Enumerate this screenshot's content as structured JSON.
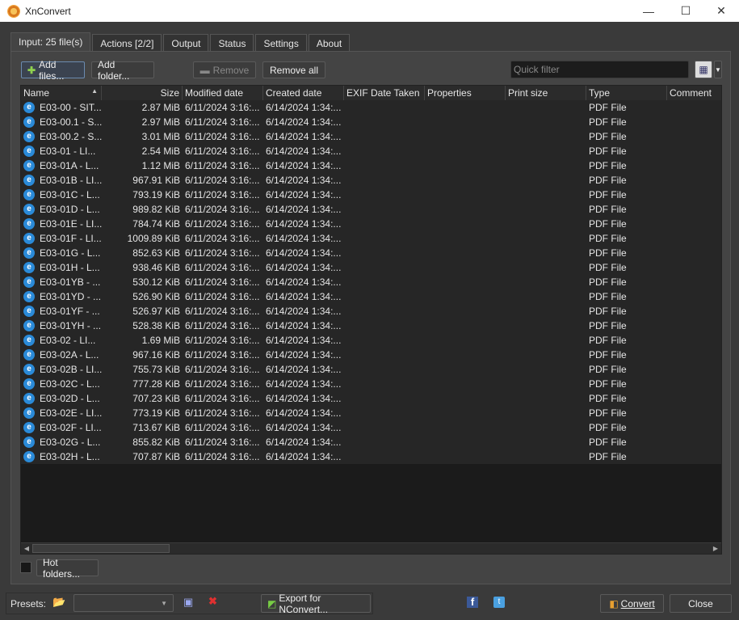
{
  "window": {
    "title": "XnConvert",
    "minimize": "—",
    "maximize": "☐",
    "close": "✕"
  },
  "tabs": [
    {
      "label": "Input: 25 file(s)"
    },
    {
      "label": "Actions [2/2]"
    },
    {
      "label": "Output"
    },
    {
      "label": "Status"
    },
    {
      "label": "Settings"
    },
    {
      "label": "About"
    }
  ],
  "toolbar": {
    "add_files": "Add files...",
    "add_folder": "Add folder...",
    "remove": "Remove",
    "remove_all": "Remove all",
    "quick_filter_placeholder": "Quick filter"
  },
  "columns": [
    "Name",
    "Size",
    "Modified date",
    "Created date",
    "EXIF Date Taken",
    "Properties",
    "Print size",
    "Type",
    "Comment"
  ],
  "files": [
    [
      "E03-00 - SIT...",
      "2.87 MiB"
    ],
    [
      "E03-00.1 - S...",
      "2.97 MiB"
    ],
    [
      "E03-00.2 - S...",
      "3.01 MiB"
    ],
    [
      "E03-01 - LI...",
      "2.54 MiB"
    ],
    [
      "E03-01A - L...",
      "1.12 MiB"
    ],
    [
      "E03-01B - LI...",
      "967.91 KiB"
    ],
    [
      "E03-01C - L...",
      "793.19 KiB"
    ],
    [
      "E03-01D - L...",
      "989.82 KiB"
    ],
    [
      "E03-01E - LI...",
      "784.74 KiB"
    ],
    [
      "E03-01F - LI...",
      "1009.89 KiB"
    ],
    [
      "E03-01G - L...",
      "852.63 KiB"
    ],
    [
      "E03-01H - L...",
      "938.46 KiB"
    ],
    [
      "E03-01YB - ...",
      "530.12 KiB"
    ],
    [
      "E03-01YD - ...",
      "526.90 KiB"
    ],
    [
      "E03-01YF - ...",
      "526.97 KiB"
    ],
    [
      "E03-01YH - ...",
      "528.38 KiB"
    ],
    [
      "E03-02 - LI...",
      "1.69 MiB"
    ],
    [
      "E03-02A - L...",
      "967.16 KiB"
    ],
    [
      "E03-02B - LI...",
      "755.73 KiB"
    ],
    [
      "E03-02C - L...",
      "777.28 KiB"
    ],
    [
      "E03-02D - L...",
      "707.23 KiB"
    ],
    [
      "E03-02E - LI...",
      "773.19 KiB"
    ],
    [
      "E03-02F - LI...",
      "713.67 KiB"
    ],
    [
      "E03-02G - L...",
      "855.82 KiB"
    ],
    [
      "E03-02H - L...",
      "707.87 KiB"
    ]
  ],
  "file_common": {
    "modified": "6/11/2024 3:16:...",
    "created": "6/14/2024 1:34:...",
    "type": "PDF File"
  },
  "hot_folders": "Hot folders...",
  "footer": {
    "presets_label": "Presets:",
    "export": "Export for NConvert...",
    "convert": "Convert",
    "close": "Close"
  }
}
